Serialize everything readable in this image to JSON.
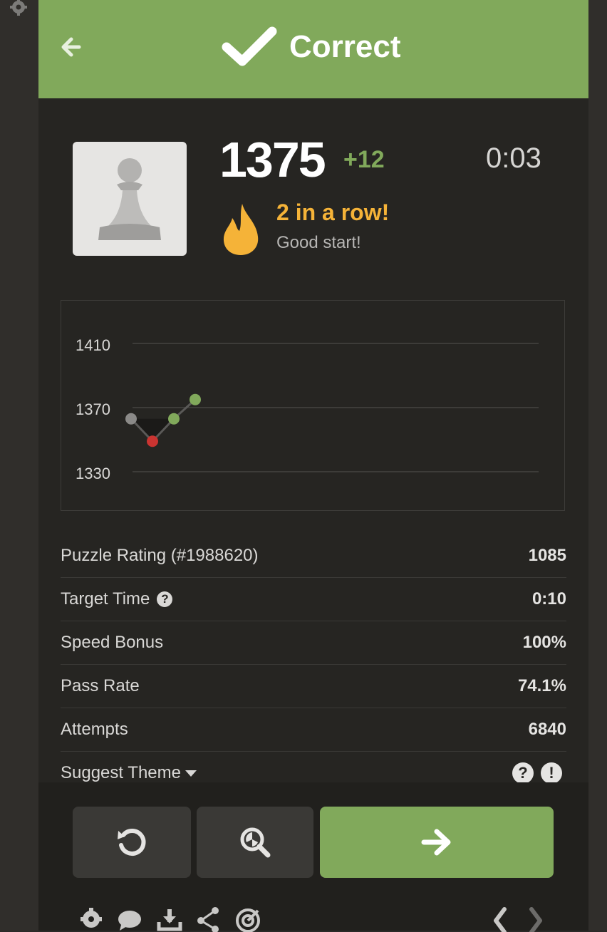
{
  "header": {
    "title": "Correct",
    "color": "#81a95b"
  },
  "result": {
    "rating": "1375",
    "rating_delta": "+12",
    "timer": "0:03",
    "streak_title": "2 in a row!",
    "streak_subtitle": "Good start!"
  },
  "chart_data": {
    "type": "line",
    "y_ticks": [
      "1410",
      "1370",
      "1330"
    ],
    "ylim": [
      1330,
      1410
    ],
    "x": [
      1,
      2,
      3,
      4
    ],
    "series": [
      {
        "values": [
          1363,
          1349,
          1363,
          1375
        ],
        "point_colors": [
          "#8b8a88",
          "#ca3431",
          "#81a95b",
          "#81a95b"
        ]
      }
    ],
    "grid": true
  },
  "stats": [
    {
      "label": "Puzzle Rating (#1988620)",
      "value": "1085"
    },
    {
      "label": "Target Time",
      "value": "0:10",
      "help": "?"
    },
    {
      "label": "Speed Bonus",
      "value": "100%"
    },
    {
      "label": "Pass Rate",
      "value": "74.1%"
    },
    {
      "label": "Attempts",
      "value": "6840"
    }
  ],
  "suggest_theme": {
    "label": "Suggest Theme",
    "help_icon": "?",
    "report_icon": "!"
  },
  "icons": {
    "back": "arrow-left-icon",
    "check": "checkmark-icon",
    "avatar": "pawn-icon",
    "streak": "flame-icon",
    "retry": "retry-icon",
    "analysis": "analysis-magnifier-icon",
    "next": "arrow-right-icon",
    "footer": [
      "gear-icon",
      "chat-icon",
      "download-icon",
      "share-icon",
      "target-icon",
      "chevron-left-icon",
      "chevron-right-icon"
    ]
  },
  "colors": {
    "accent_green": "#81a95b",
    "streak_orange": "#f5b338",
    "fail_red": "#ca3431"
  }
}
